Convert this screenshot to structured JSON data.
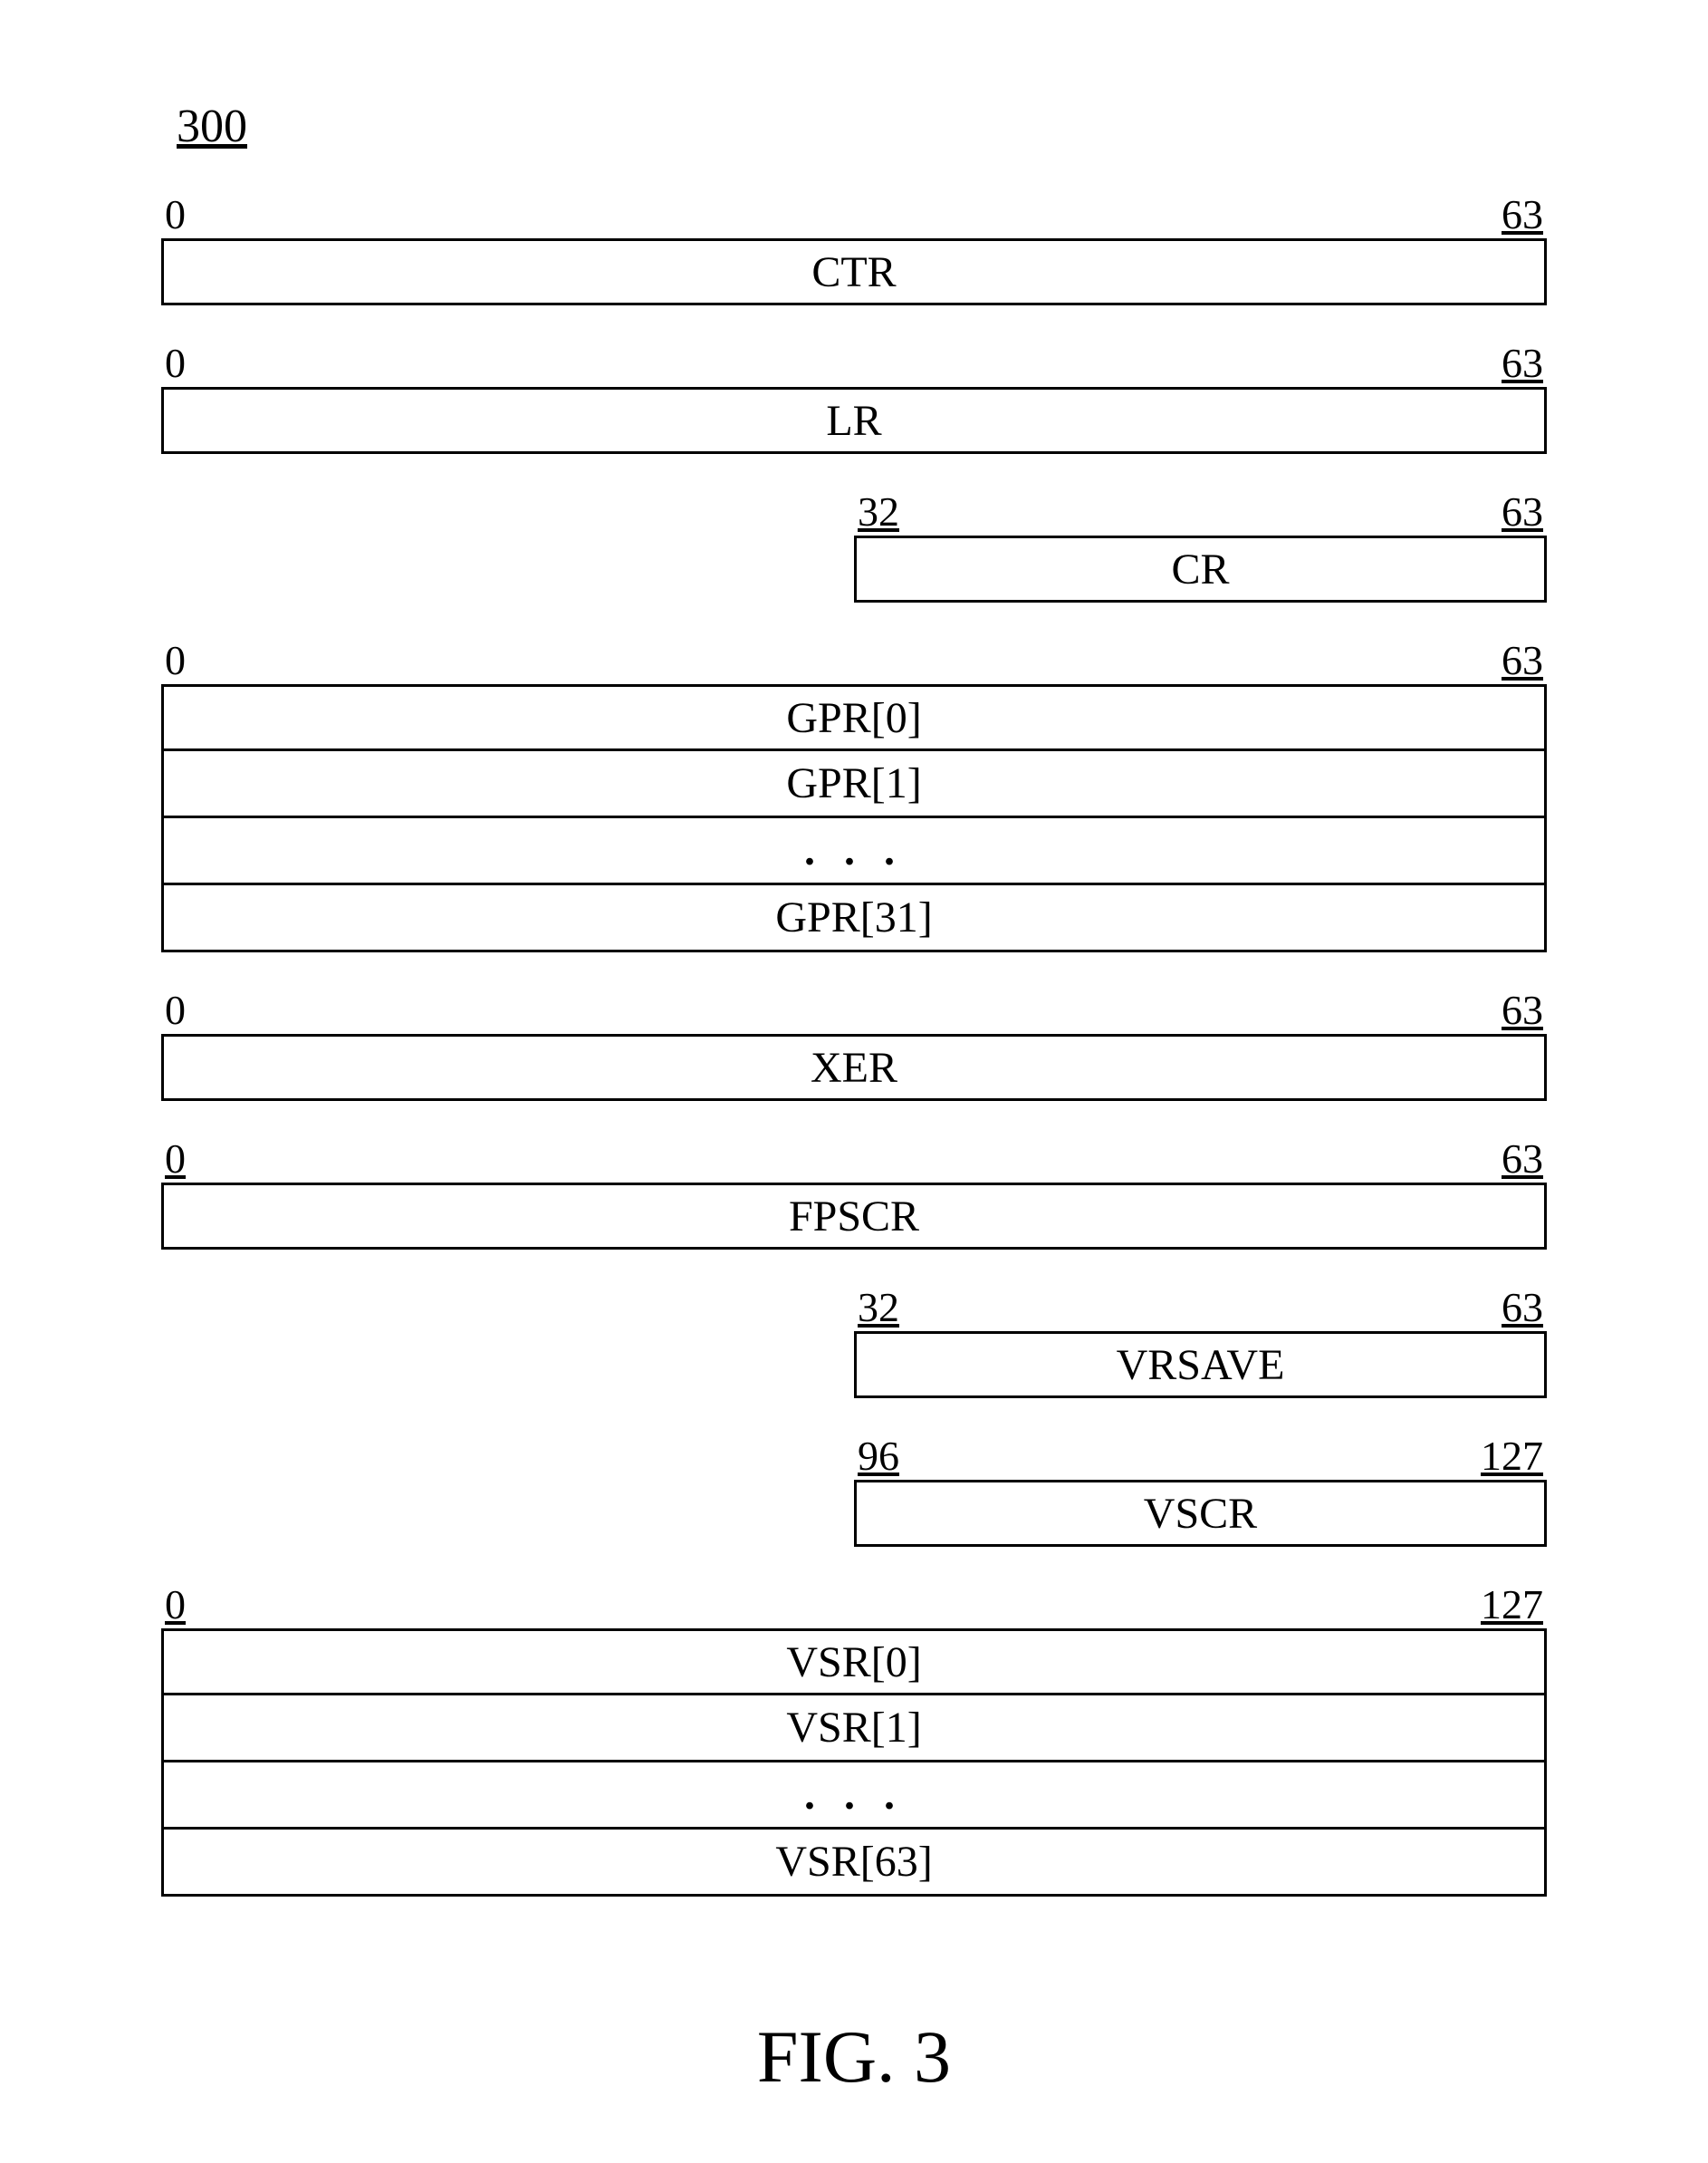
{
  "figure_number": "300",
  "caption": "FIG. 3",
  "ellipsis": ". . .",
  "chart_data": {
    "type": "table",
    "title": "User-level register set (PowerPC-style)",
    "registers": [
      {
        "name": "CTR",
        "bit_start": 0,
        "bit_end": 63,
        "count": 1,
        "width_bits": 64
      },
      {
        "name": "LR",
        "bit_start": 0,
        "bit_end": 63,
        "count": 1,
        "width_bits": 64
      },
      {
        "name": "CR",
        "bit_start": 32,
        "bit_end": 63,
        "count": 1,
        "width_bits": 32
      },
      {
        "name": "GPR",
        "bit_start": 0,
        "bit_end": 63,
        "count": 32,
        "width_bits": 64
      },
      {
        "name": "XER",
        "bit_start": 0,
        "bit_end": 63,
        "count": 1,
        "width_bits": 64
      },
      {
        "name": "FPSCR",
        "bit_start": 0,
        "bit_end": 63,
        "count": 1,
        "width_bits": 64
      },
      {
        "name": "VRSAVE",
        "bit_start": 32,
        "bit_end": 63,
        "count": 1,
        "width_bits": 32
      },
      {
        "name": "VSCR",
        "bit_start": 96,
        "bit_end": 127,
        "count": 1,
        "width_bits": 32
      },
      {
        "name": "VSR",
        "bit_start": 0,
        "bit_end": 127,
        "count": 64,
        "width_bits": 128
      }
    ]
  },
  "labels": {
    "ctr": {
      "start": "0",
      "end": "63",
      "name": "CTR"
    },
    "lr": {
      "start": "0",
      "end": "63",
      "name": "LR"
    },
    "cr": {
      "start": "32",
      "end": "63",
      "name": "CR"
    },
    "gpr": {
      "start": "0",
      "end": "63",
      "r0": "GPR[0]",
      "r1": "GPR[1]",
      "r31": "GPR[31]"
    },
    "xer": {
      "start": "0",
      "end": "63",
      "name": "XER"
    },
    "fpscr": {
      "start": "0",
      "end": "63",
      "name": "FPSCR"
    },
    "vrsave": {
      "start": "32",
      "end": "63",
      "name": "VRSAVE"
    },
    "vscr": {
      "start": "96",
      "end": "127",
      "name": "VSCR"
    },
    "vsr": {
      "start": "0",
      "end": "127",
      "r0": "VSR[0]",
      "r1": "VSR[1]",
      "r63": "VSR[63]"
    }
  }
}
